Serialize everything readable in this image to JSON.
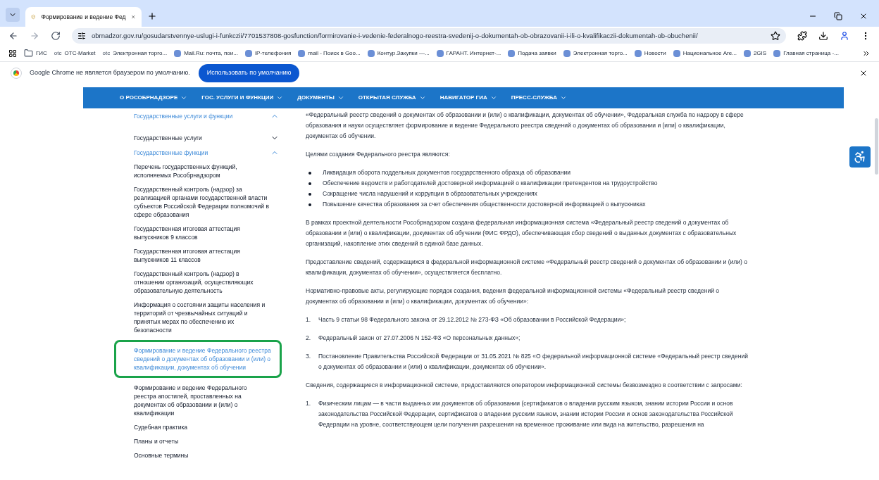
{
  "browser": {
    "tab_title": "Формирование и ведение Фед",
    "url": "obrnadzor.gov.ru/gosudarstvennye-uslugi-i-funkczii/7701537808-gosfunction/formirovanie-i-vedenie-federalnogo-reestra-svedenij-o-dokumentah-ob-obrazovanii-i-ili-o-kvalifikaczii-dokumentah-ob-obuchenii/",
    "bookmarks": [
      {
        "kind": "folder",
        "label": "ГИС"
      },
      {
        "kind": "text",
        "badge": "otc",
        "label": "OTC-Market"
      },
      {
        "kind": "text",
        "badge": "otc",
        "label": "Электронная торго..."
      },
      {
        "kind": "site",
        "label": "Mail.Ru: почта, пои..."
      },
      {
        "kind": "site",
        "label": "IP-телефония"
      },
      {
        "kind": "site",
        "label": "mail - Поиск в Goo..."
      },
      {
        "kind": "site",
        "label": "Контур.Закупки —..."
      },
      {
        "kind": "site",
        "label": "ГАРАНТ. Интернет-..."
      },
      {
        "kind": "site",
        "label": "Подача заявки"
      },
      {
        "kind": "site",
        "label": "Электронная торго..."
      },
      {
        "kind": "site",
        "label": "Новости"
      },
      {
        "kind": "site",
        "label": "Национальное Аге..."
      },
      {
        "kind": "site",
        "label": "2GIS"
      },
      {
        "kind": "site",
        "label": "Главная страница -..."
      }
    ],
    "infobar": {
      "message": "Google Chrome не является браузером по умолчанию.",
      "button": "Использовать по умолчанию"
    }
  },
  "nav": [
    "О РОСОБРНАДЗОРЕ",
    "ГОС. УСЛУГИ И ФУНКЦИИ",
    "ДОКУМЕНТЫ",
    "ОТКРЫТАЯ СЛУЖБА",
    "НАВИГАТОР ГИА",
    "ПРЕСС-СЛУЖБА"
  ],
  "sidebar": [
    {
      "kind": "section",
      "label": "Государственные услуги и функции",
      "expanded": true
    },
    {
      "kind": "section",
      "label": "Государственные услуги",
      "expanded": false
    },
    {
      "kind": "section",
      "label": "Государственные функции",
      "expanded": true
    },
    {
      "kind": "link",
      "label": "Перечень государственных функций, исполняемых Рособрнадзором",
      "selected": false
    },
    {
      "kind": "link",
      "label": "Государственный контроль (надзор) за реализацией органами государственной власти субъектов Российской Федерации полномочий в сфере образования",
      "selected": false
    },
    {
      "kind": "link",
      "label": "Государственная итоговая аттестация выпускников 9 классов",
      "selected": false
    },
    {
      "kind": "link",
      "label": "Государственная итоговая аттестация выпускников 11 классов",
      "selected": false
    },
    {
      "kind": "link",
      "label": "Государственный контроль (надзор) в отношении организаций, осуществляющих образовательную деятельность",
      "selected": false
    },
    {
      "kind": "link",
      "label": "Информация о состоянии защиты населения и территорий от чрезвычайных ситуаций и принятых мерах по обеспечению их безопасности",
      "selected": false
    },
    {
      "kind": "link",
      "label": "Формирование и ведение Федерального реестра сведений о документах об образовании и (или) о квалификации, документах об обучении",
      "selected": true
    },
    {
      "kind": "link",
      "label": "Формирование и ведение Федерального реестра апостилей, проставленных на документах об образовании и (или) о квалификации",
      "selected": false
    },
    {
      "kind": "link",
      "label": "Судебная практика",
      "selected": false
    },
    {
      "kind": "link",
      "label": "Планы и отчеты",
      "selected": false
    },
    {
      "kind": "link",
      "label": "Основные термины",
      "selected": false
    }
  ],
  "content": [
    {
      "kind": "paragraph",
      "text": "«Федеральный реестр сведений о документах об образовании и (или) о квалификации, документах об обучении», Федеральная служба по надзору в сфере образования и науки осуществляет формирование и ведение Федерального реестра сведений о документах об образовании и (или) о квалификации, документах об обучении."
    },
    {
      "kind": "paragraph",
      "text": "Целями создания Федерального реестра являются:"
    },
    {
      "kind": "bullets",
      "items": [
        "Ликвидация оборота поддельных документов государственного образца об образовании",
        "Обеспечение ведомств и работодателей достоверной информацией о квалификации претендентов на трудоустройство",
        "Сокращение числа нарушений и коррупции в образовательных учреждениях",
        "Повышение качества образования за счет обеспечения общественности достоверной информацией о выпускниках"
      ]
    },
    {
      "kind": "paragraph",
      "text": "В рамках проектной деятельности Рособрнадзором создана федеральная информационная система «Федеральный реестр сведений о документах об образовании и (или) о квалификации, документах об обучении (ФИС ФРДО), обеспечивающая сбор сведений о выданных документах с образовательных организаций, накопление этих сведений в единой базе данных."
    },
    {
      "kind": "paragraph",
      "text": "Предоставление сведений, содержащихся в федеральной информационной системе «Федеральный реестр сведений о документах об образовании и (или) о квалификации, документах об обучении», осуществляется бесплатно."
    },
    {
      "kind": "paragraph",
      "text": "Нормативно-правовые акты, регулирующие порядок создания, ведения федеральной информационной системы «Федеральный реестр сведений о документах об образовании и (или) о квалификации, документах об обучении»:"
    },
    {
      "kind": "numbered",
      "number": "1.",
      "text": "Часть 9 статьи 98 Федерального закона от 29.12.2012 № 273-ФЗ «Об образовании в Российской Федерации»;"
    },
    {
      "kind": "numbered",
      "number": "2.",
      "text": "Федеральный закон от 27.07.2006 N 152-ФЗ «О персональных данных»;"
    },
    {
      "kind": "numbered",
      "number": "3.",
      "text": "Постановление Правительства Российской Федерации от 31.05.2021 № 825 «О федеральной информационной системе «Федеральный реестр сведений о документах об образовании и (или) о квалификации, документах об обучении»."
    },
    {
      "kind": "paragraph",
      "text": "Сведения, содержащиеся в информационной системе, предоставляются оператором информационной системы безвозмездно в соответствии с запросами:"
    },
    {
      "kind": "numbered",
      "number": "1.",
      "text": "Физическим лицам — в части выданных им документов об образовании (сертификатов о владении русским языком, знании истории России и основ законодательства Российской Федерации, сертификатов о владении русским языком, знании истории России и основ законодательства Российской Федерации на уровне, соответствующем цели получения разрешения на временное проживание или вида на жительство, разрешения на"
    }
  ]
}
